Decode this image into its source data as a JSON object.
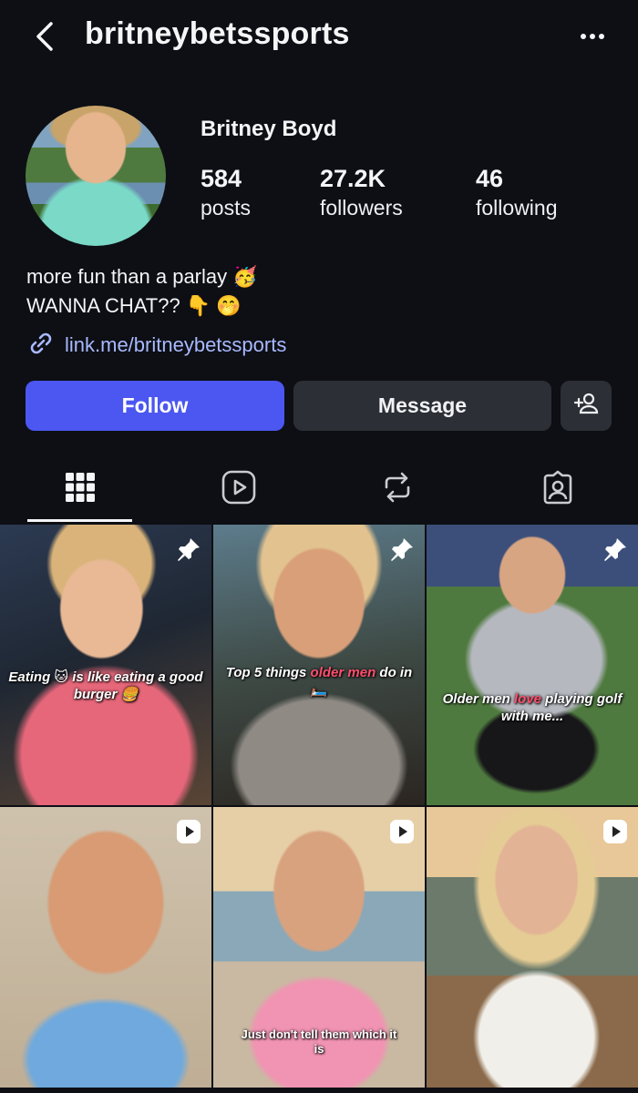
{
  "header": {
    "username": "britneybetssports",
    "back_icon": "chevron-left-icon",
    "more_icon": "ellipsis-icon"
  },
  "profile": {
    "display_name": "Britney Boyd",
    "stats": {
      "posts": {
        "value": "584",
        "label": "posts"
      },
      "followers": {
        "value": "27.2K",
        "label": "followers"
      },
      "following": {
        "value": "46",
        "label": "following"
      }
    },
    "bio_line1": "more fun than a parlay 🥳",
    "bio_line2": "WANNA CHAT?? 👇 🤭",
    "link": "link.me/britneybetssports"
  },
  "actions": {
    "follow_label": "Follow",
    "message_label": "Message",
    "add_user_icon": "add-person-icon"
  },
  "tabs": [
    {
      "icon": "grid-icon",
      "selected": true
    },
    {
      "icon": "reels-icon",
      "selected": false
    },
    {
      "icon": "reposts-icon",
      "selected": false
    },
    {
      "icon": "tagged-icon",
      "selected": false
    }
  ],
  "grid": [
    {
      "caption": "Eating 🐱 is like eating a good burger 🍔",
      "badge": "pin-icon"
    },
    {
      "caption_pre": "Top 5 things ",
      "caption_hl": "older men",
      "caption_post": " do in 🛏️",
      "badge": "pin-icon"
    },
    {
      "caption_pre": "Older men ",
      "caption_hl": "love",
      "caption_post": " playing golf with me...",
      "badge": "pin-icon"
    },
    {
      "caption": "",
      "badge": "reel-icon"
    },
    {
      "caption": "Just don't tell them which it is",
      "badge": "reel-icon"
    },
    {
      "caption": "",
      "badge": "reel-icon"
    }
  ],
  "colors": {
    "background": "#0d0f14",
    "follow_button": "#4b57f0",
    "secondary_button": "#2c2f36",
    "link": "#a9b9ff",
    "caption_highlight": "#ff4f6d"
  }
}
